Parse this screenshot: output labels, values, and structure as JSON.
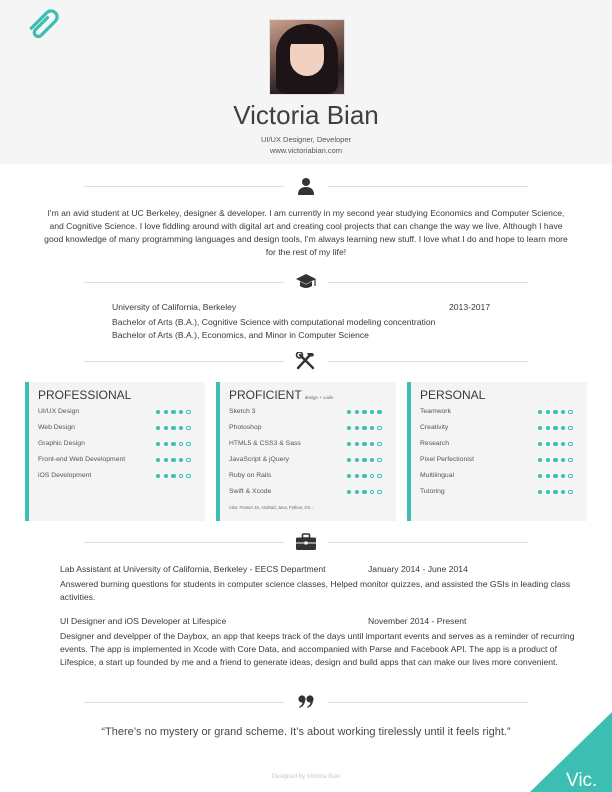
{
  "profile": {
    "name": "Victoria Bian",
    "role": "UI/UX Designer, Developer",
    "website": "www.victoriabian.com"
  },
  "about": "I'm an avid student at UC Berkeley, designer & developer. I am currently in my second year studying Economics and Computer Science, and Cognitive Science. I love fiddling around with digital art and creating cool projects that can change the way we live.  Although I have good knowledge of many programming languages and design tools, I'm always learning new stuff. I love what I do and hope to learn more for the rest of my life!",
  "education": {
    "school": "University of California, Berkeley",
    "dates": "2013-2017",
    "degree1": "Bachelor of Arts (B.A.), Cognitive Science with computational modeling concentration",
    "degree2": "Bachelor of Arts (B.A.), Economics, and Minor in Computer Science"
  },
  "skills": {
    "professional": {
      "title": "PROFESSIONAL",
      "items": [
        {
          "label": "UI/UX Design",
          "level": 4
        },
        {
          "label": "Web Design",
          "level": 4
        },
        {
          "label": "Graphic Design",
          "level": 3
        },
        {
          "label": "Front-end Web Development",
          "level": 4
        },
        {
          "label": "iOS Development",
          "level": 3
        }
      ]
    },
    "proficient": {
      "title": "PROFICIENT",
      "subtitle": "design + code",
      "items": [
        {
          "label": "Sketch 3",
          "level": 5
        },
        {
          "label": "Photoshop",
          "level": 4
        },
        {
          "label": "HTML5 & CSS3 & Sass",
          "level": 4
        },
        {
          "label": "JavaScript & jQuery",
          "level": 4
        },
        {
          "label": "Ruby on Rails",
          "level": 3
        },
        {
          "label": "Swift & Xcode",
          "level": 3
        }
      ],
      "also": "Also: Framer JS, Android, Java, Python, Git ..."
    },
    "personal": {
      "title": "PERSONAL",
      "items": [
        {
          "label": "Teamwork",
          "level": 4
        },
        {
          "label": "Creativity",
          "level": 4
        },
        {
          "label": "Research",
          "level": 4
        },
        {
          "label": "Pixel Perfectionist",
          "level": 4
        },
        {
          "label": "Multilingual",
          "level": 4
        },
        {
          "label": "Tutoring",
          "level": 4
        }
      ]
    },
    "max_level": 5
  },
  "experience": {
    "job1": {
      "title": "Lab Assistant at University of California, Berkeley - EECS Department",
      "dates": "January 2014 - June 2014",
      "desc": "Answered burning questions for students in computer science classes, Helped monitor quizzes, and assisted the GSIs in leading class activities."
    },
    "job2": {
      "title": "UI Designer and iOS Developer at Lifespice",
      "dates": "November 2014 - Present",
      "desc": "Designer and develpper of the Daybox, an app that keeps track of the days until important events and serves as a reminder of recurring events. The app is implemented in Xcode with Core Data, and accompanied with Parse and Facebook API. The app is a product of Lifespice, a start up founded by me and a friend to generate ideas, design and build apps that can make our lives more convenient."
    }
  },
  "quote": "“There’s no mystery or grand scheme. It’s about working tirelessly until it feels right.”",
  "footer": "Designed by Victoria Bian",
  "corner_label": "Vic.",
  "colors": {
    "accent": "#3cbfb2",
    "header_bg": "#f5f5f5",
    "card_bg": "#f4f4f4"
  },
  "icons": {
    "clip": "paperclip-icon",
    "about": "user-icon",
    "education": "graduation-cap-icon",
    "skills": "tools-icon",
    "experience": "briefcase-icon",
    "quote": "quote-icon"
  }
}
